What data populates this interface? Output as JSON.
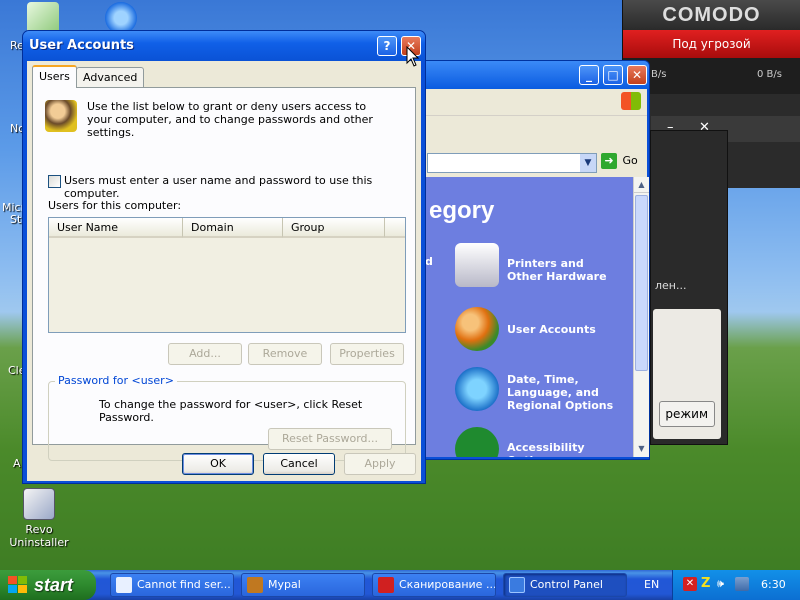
{
  "desktop": {
    "edge_labels": [
      "Re",
      "No",
      "Micr",
      "St",
      "Cle",
      "A"
    ],
    "revo": "Revo\nUninstaller"
  },
  "comodo": {
    "logo": "COMODO",
    "status": "Под угрозой",
    "speed_in": "B/s",
    "speed_out": "0 B/s"
  },
  "bg_window": {
    "text_fragment": "лен...",
    "button_fragment": "режим"
  },
  "control_panel": {
    "address_go": "Go",
    "heading_fragment": "egory",
    "left_fragments": [
      "d"
    ],
    "categories": [
      {
        "label": "Printers and\nOther Hardware",
        "icon": "printer-icon"
      },
      {
        "label": "User Accounts",
        "icon": "users-icon"
      },
      {
        "label": "Date, Time,\nLanguage, and\nRegional Options",
        "icon": "globe-calendar-icon"
      },
      {
        "label": "Accessibility\nOptions",
        "icon": "accessibility-icon"
      }
    ]
  },
  "dialog": {
    "title": "User Accounts",
    "help_btn": "?",
    "tabs": [
      "Users",
      "Advanced"
    ],
    "intro": "Use the list below to grant or deny users access to your computer, and to change passwords and other settings.",
    "checkbox_label": "Users must enter a user name and password to use this computer.",
    "users_label": "Users for this computer:",
    "columns": [
      "User Name",
      "Domain",
      "Group"
    ],
    "add": "Add...",
    "remove": "Remove",
    "properties": "Properties",
    "password_group": "Password for <user>",
    "password_text": "To change the password for <user>, click Reset Password.",
    "reset": "Reset Password...",
    "ok": "OK",
    "cancel": "Cancel",
    "apply": "Apply"
  },
  "taskbar": {
    "start": "start",
    "tasks": [
      {
        "label": "Cannot find ser...",
        "icon_color": "#e8f0ff"
      },
      {
        "label": "Mypal",
        "icon_color": "#c07820"
      },
      {
        "label": "Сканирование ...",
        "icon_color": "#d02020"
      },
      {
        "label": "Control Panel",
        "icon_color": "#3a7be0"
      }
    ],
    "lang": "EN",
    "clock": "6:30"
  }
}
